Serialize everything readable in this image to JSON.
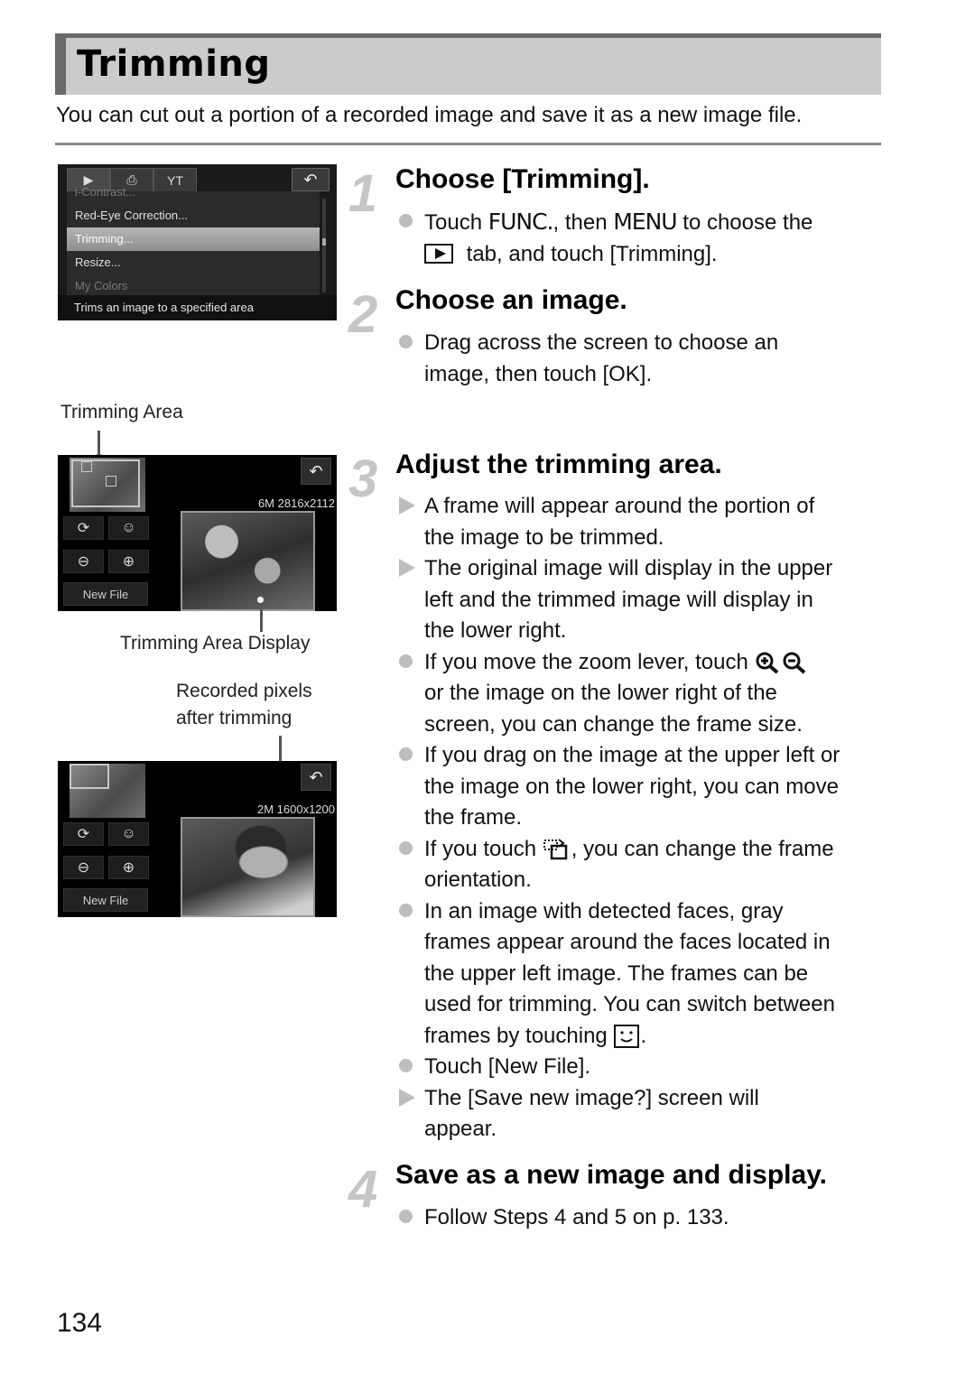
{
  "page": {
    "title": "Trimming",
    "intro": "You can cut out a portion of a recorded image and save it as a new image file.",
    "page_number": "134"
  },
  "menu_screen": {
    "tabs": [
      {
        "name": "playback-tab",
        "glyph": "▶"
      },
      {
        "name": "print-tab",
        "glyph": "⎙"
      },
      {
        "name": "settings-tab",
        "glyph": "YT"
      }
    ],
    "back_glyph": "↶",
    "items": [
      {
        "label": "i-Contrast...",
        "state": "faded"
      },
      {
        "label": "Red-Eye Correction...",
        "state": "normal"
      },
      {
        "label": "Trimming...",
        "state": "selected"
      },
      {
        "label": "Resize...",
        "state": "normal"
      },
      {
        "label": "My Colors",
        "state": "faded"
      }
    ],
    "help_text": "Trims an image to a specified area"
  },
  "trim_screens": [
    {
      "resolution": "6M 2816x2112",
      "buttons": {
        "rotate": "⟳",
        "face": "☺",
        "zoom_out": "⊖",
        "zoom_in": "⊕",
        "new_file": "New File",
        "back": "↶"
      }
    },
    {
      "resolution": "2M 1600x1200",
      "buttons": {
        "rotate": "⟳",
        "face": "☺",
        "zoom_out": "⊖",
        "zoom_in": "⊕",
        "new_file": "New File",
        "back": "↶"
      }
    }
  ],
  "callouts": {
    "trimming_area": "Trimming Area",
    "trimming_area_display": "Trimming Area Display",
    "recorded_pixels_line1": "Recorded pixels",
    "recorded_pixels_line2": "after trimming"
  },
  "steps": [
    {
      "number": "1",
      "title": "Choose [Trimming].",
      "bullets": [
        {
          "type": "dot",
          "parts": {
            "pre": "Touch ",
            "kw1": "FUNC.",
            "mid": ", then ",
            "kw2": "MENU",
            "post": " to choose the",
            "line2": " tab, and touch [Trimming]."
          }
        }
      ]
    },
    {
      "number": "2",
      "title": "Choose an image.",
      "bullets": [
        {
          "type": "dot",
          "text": "Drag across the screen to choose an\nimage, then touch [OK]."
        }
      ]
    },
    {
      "number": "3",
      "title": "Adjust the trimming area.",
      "bullets": [
        {
          "type": "arrow",
          "text": "A frame will appear around the portion of\nthe image to be trimmed."
        },
        {
          "type": "arrow",
          "text": "The original image will display in the upper\nleft and the trimmed image will display in\nthe lower right."
        },
        {
          "type": "dot",
          "text_pre": "If you move the zoom lever, touch ",
          "text_post": "\nor the image on the lower right of the\nscreen, you can change the frame size."
        },
        {
          "type": "dot",
          "text": "If you drag on the image at the upper left or\nthe image on the lower right, you can move\nthe frame."
        },
        {
          "type": "dot",
          "text_pre": "If you touch ",
          "text_post": ", you can change the frame\norientation."
        },
        {
          "type": "dot",
          "text_pre": "In an image with detected faces, gray\nframes appear around the faces located in\nthe upper left image. The frames can be\nused for trimming. You can switch between\nframes by touching ",
          "text_post": "."
        },
        {
          "type": "dot",
          "text": "Touch [New File]."
        },
        {
          "type": "arrow",
          "text": "The [Save new image?] screen will\nappear."
        }
      ]
    },
    {
      "number": "4",
      "title": "Save as a new image and display.",
      "bullets": [
        {
          "type": "dot",
          "text": "Follow Steps 4 and 5 on p. 133."
        }
      ]
    }
  ]
}
